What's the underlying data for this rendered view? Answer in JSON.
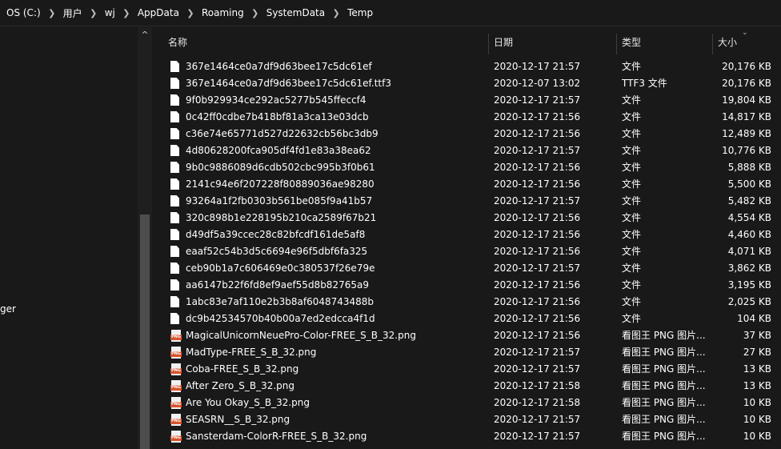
{
  "breadcrumb": [
    "OS (C:)",
    "用户",
    "wj",
    "AppData",
    "Roaming",
    "SystemData",
    "Temp"
  ],
  "nav": {
    "partial_label": "ger",
    "scroll_up_glyph": "^"
  },
  "columns": {
    "name": "名称",
    "date": "日期",
    "type": "类型",
    "size": "大小"
  },
  "icons": {
    "sort": "chevron-down-icon",
    "doc": "document-icon",
    "png": "png-image-icon",
    "png_badge": "PNG"
  },
  "files": [
    {
      "name": "367e1464ce0a7df9d63bee17c5dc61ef",
      "date": "2020-12-17 21:57",
      "type": "文件",
      "size": "20,176 KB",
      "icon": "doc"
    },
    {
      "name": "367e1464ce0a7df9d63bee17c5dc61ef.ttf3",
      "date": "2020-12-07 13:02",
      "type": "TTF3 文件",
      "size": "20,176 KB",
      "icon": "doc"
    },
    {
      "name": "9f0b929934ce292ac5277b545ffeccf4",
      "date": "2020-12-17 21:57",
      "type": "文件",
      "size": "19,804 KB",
      "icon": "doc"
    },
    {
      "name": "0c42ff0cdbe7b418bf81a3ca13e03dcb",
      "date": "2020-12-17 21:56",
      "type": "文件",
      "size": "14,817 KB",
      "icon": "doc"
    },
    {
      "name": "c36e74e65771d527d22632cb56bc3db9",
      "date": "2020-12-17 21:56",
      "type": "文件",
      "size": "12,489 KB",
      "icon": "doc"
    },
    {
      "name": "4d80628200fca905df4fd1e83a38ea62",
      "date": "2020-12-17 21:57",
      "type": "文件",
      "size": "10,776 KB",
      "icon": "doc"
    },
    {
      "name": "9b0c9886089d6cdb502cbc995b3f0b61",
      "date": "2020-12-17 21:56",
      "type": "文件",
      "size": "5,888 KB",
      "icon": "doc"
    },
    {
      "name": "2141c94e6f207228f80889036ae98280",
      "date": "2020-12-17 21:56",
      "type": "文件",
      "size": "5,500 KB",
      "icon": "doc"
    },
    {
      "name": "93264a1f2fb0303b561be085f9a41b57",
      "date": "2020-12-17 21:57",
      "type": "文件",
      "size": "5,482 KB",
      "icon": "doc"
    },
    {
      "name": "320c898b1e228195b210ca2589f67b21",
      "date": "2020-12-17 21:56",
      "type": "文件",
      "size": "4,554 KB",
      "icon": "doc"
    },
    {
      "name": "d49df5a39ccec28c82bfcdf161de5af8",
      "date": "2020-12-17 21:56",
      "type": "文件",
      "size": "4,460 KB",
      "icon": "doc"
    },
    {
      "name": "eaaf52c54b3d5c6694e96f5dbf6fa325",
      "date": "2020-12-17 21:56",
      "type": "文件",
      "size": "4,071 KB",
      "icon": "doc"
    },
    {
      "name": "ceb90b1a7c606469e0c380537f26e79e",
      "date": "2020-12-17 21:57",
      "type": "文件",
      "size": "3,862 KB",
      "icon": "doc"
    },
    {
      "name": "aa6147b22f6fd8ef9aef55d8b82765a9",
      "date": "2020-12-17 21:56",
      "type": "文件",
      "size": "3,195 KB",
      "icon": "doc"
    },
    {
      "name": "1abc83e7af110e2b3b8af6048743488b",
      "date": "2020-12-17 21:56",
      "type": "文件",
      "size": "2,025 KB",
      "icon": "doc"
    },
    {
      "name": "dc9b42534570b40b00a7ed2edcca4f1d",
      "date": "2020-12-17 21:56",
      "type": "文件",
      "size": "104 KB",
      "icon": "doc"
    },
    {
      "name": "MagicalUnicornNeuePro-Color-FREE_S_B_32.png",
      "date": "2020-12-17 21:56",
      "type": "看图王 PNG 图片...",
      "size": "37 KB",
      "icon": "png"
    },
    {
      "name": "MadType-FREE_S_B_32.png",
      "date": "2020-12-17 21:57",
      "type": "看图王 PNG 图片...",
      "size": "27 KB",
      "icon": "png"
    },
    {
      "name": "Coba-FREE_S_B_32.png",
      "date": "2020-12-17 21:57",
      "type": "看图王 PNG 图片...",
      "size": "13 KB",
      "icon": "png"
    },
    {
      "name": "After Zero_S_B_32.png",
      "date": "2020-12-17 21:58",
      "type": "看图王 PNG 图片...",
      "size": "13 KB",
      "icon": "png"
    },
    {
      "name": "Are You Okay_S_B_32.png",
      "date": "2020-12-17 21:58",
      "type": "看图王 PNG 图片...",
      "size": "10 KB",
      "icon": "png"
    },
    {
      "name": "SEASRN__S_B_32.png",
      "date": "2020-12-17 21:57",
      "type": "看图王 PNG 图片...",
      "size": "10 KB",
      "icon": "png"
    },
    {
      "name": "Sansterdam-ColorR-FREE_S_B_32.png",
      "date": "2020-12-17 21:57",
      "type": "看图王 PNG 图片...",
      "size": "10 KB",
      "icon": "png"
    }
  ]
}
